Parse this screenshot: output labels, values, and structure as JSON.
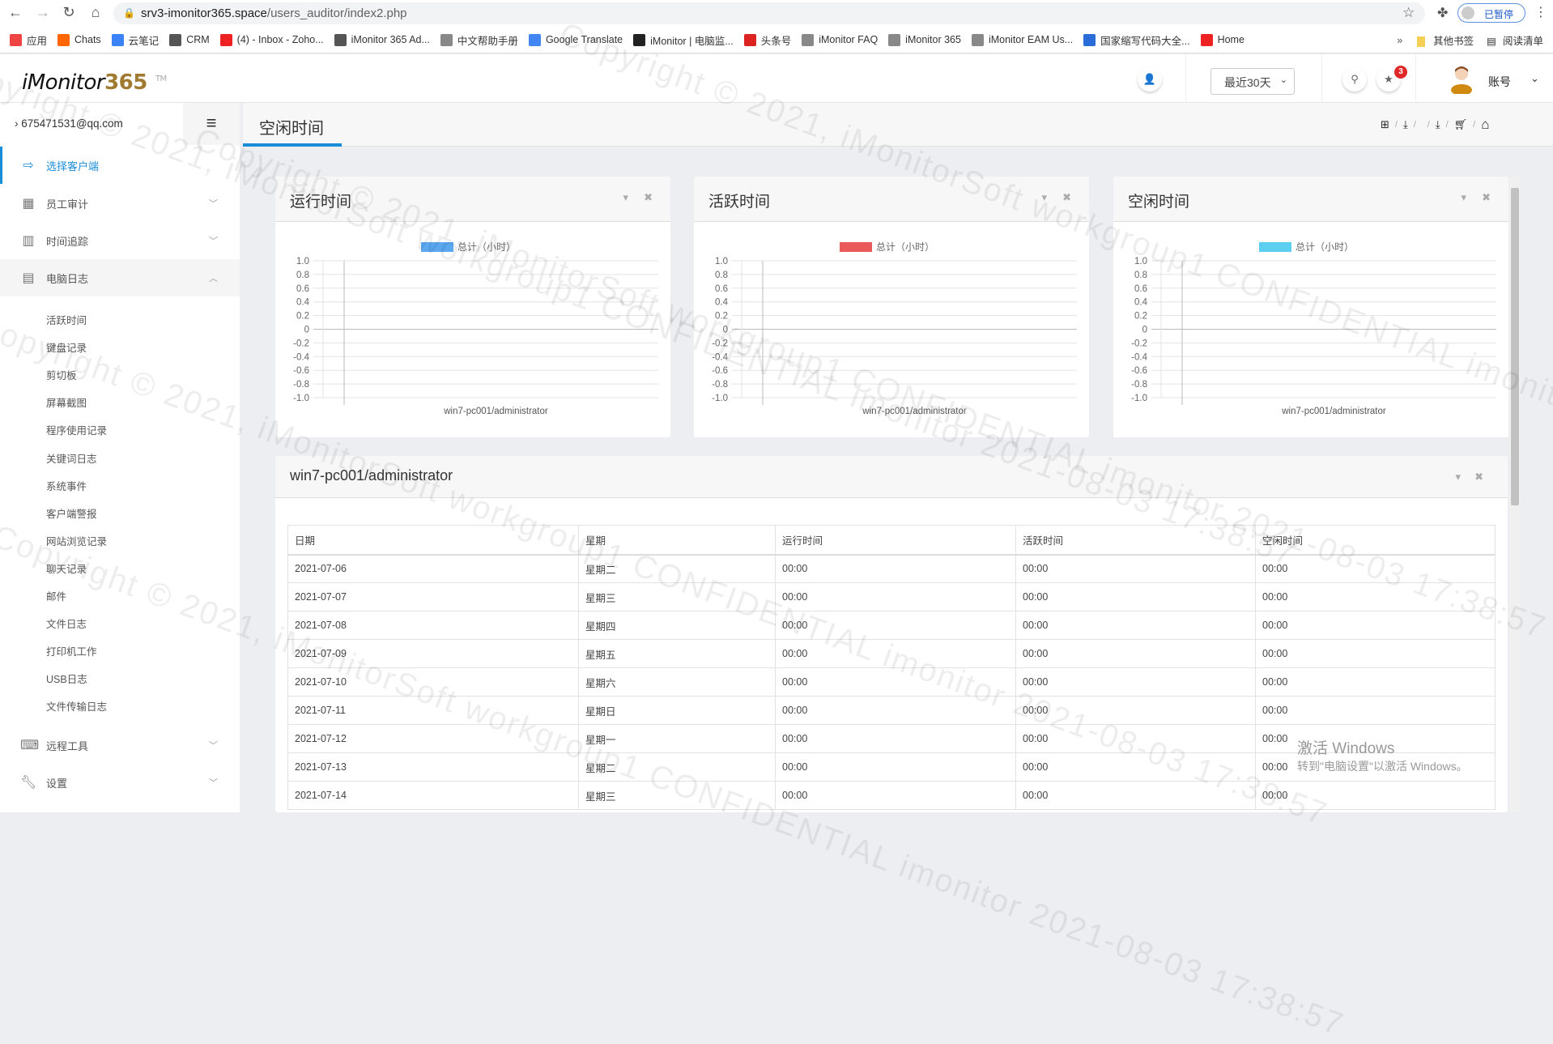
{
  "browser": {
    "url_host": "srv3-imonitor365.space",
    "url_path": "/users_auditor/index2.php",
    "profile_status": "已暂停",
    "bookmarks": [
      "应用",
      "Chats",
      "云笔记",
      "CRM",
      "(4) - Inbox - Zoho...",
      "iMonitor 365 Ad...",
      "中文帮助手册",
      "Google Translate",
      "iMonitor | 电脑监...",
      "头条号",
      "iMonitor FAQ",
      "iMonitor 365",
      "iMonitor EAM Us...",
      "国家缩写代码大全...",
      "Home"
    ],
    "bookmarks_more": "»",
    "other_bookmarks": "其他书签",
    "reading_list": "阅读清单"
  },
  "header": {
    "logo_text": "iMonitor",
    "logo_num": "365",
    "logo_tm": "TM",
    "range_select": "最近30天",
    "notification_count": "3",
    "account_label": "账号"
  },
  "sidebar": {
    "user_email": "675471531@qq.com",
    "items": [
      {
        "label": "选择客户端",
        "icon": "sign-in-icon"
      },
      {
        "label": "员工审计",
        "icon": "calendar-icon"
      },
      {
        "label": "时间追踪",
        "icon": "bar-chart-icon"
      },
      {
        "label": "电脑日志",
        "icon": "file-icon"
      },
      {
        "label": "远程工具",
        "icon": "keyboard-icon"
      },
      {
        "label": "设置",
        "icon": "wrench-icon"
      }
    ],
    "sub_items": [
      "活跃时间",
      "键盘记录",
      "剪切板",
      "屏幕截图",
      "程序使用记录",
      "关键词日志",
      "系统事件",
      "客户端警报",
      "网站浏览记录",
      "聊天记录",
      "邮件",
      "文件日志",
      "打印机工作",
      "USB日志",
      "文件传输日志"
    ]
  },
  "page": {
    "title": "空闲时间",
    "toolbar_icons": [
      "windows-icon",
      "download-icon",
      "apple-icon",
      "download-icon",
      "cart-icon",
      "home-icon"
    ]
  },
  "chart_data": [
    {
      "type": "bar",
      "title": "运行时间",
      "legend": "总计（小时）",
      "color": "#5aa8f0",
      "categories": [
        "win7-pc001/administrator"
      ],
      "values": [
        0
      ],
      "ylim": [
        -1,
        1
      ],
      "yticks": [
        "1.0",
        "0.8",
        "0.6",
        "0.4",
        "0.2",
        "0",
        "-0.2",
        "-0.4",
        "-0.6",
        "-0.8",
        "-1.0"
      ],
      "grid": true,
      "legend_position": "top"
    },
    {
      "type": "bar",
      "title": "活跃时间",
      "legend": "总计（小时）",
      "color": "#ea5a5a",
      "categories": [
        "win7-pc001/administrator"
      ],
      "values": [
        0
      ],
      "ylim": [
        -1,
        1
      ],
      "yticks": [
        "1.0",
        "0.8",
        "0.6",
        "0.4",
        "0.2",
        "0",
        "-0.2",
        "-0.4",
        "-0.6",
        "-0.8",
        "-1.0"
      ],
      "grid": true,
      "legend_position": "top"
    },
    {
      "type": "bar",
      "title": "空闲时间",
      "legend": "总计（小时）",
      "color": "#5ccff0",
      "categories": [
        "win7-pc001/administrator"
      ],
      "values": [
        0
      ],
      "ylim": [
        -1,
        1
      ],
      "yticks": [
        "1.0",
        "0.8",
        "0.6",
        "0.4",
        "0.2",
        "0",
        "-0.2",
        "-0.4",
        "-0.6",
        "-0.8",
        "-1.0"
      ],
      "grid": true,
      "legend_position": "top"
    }
  ],
  "table_card": {
    "title": "win7-pc001/administrator",
    "columns": [
      "日期",
      "星期",
      "运行时间",
      "活跃时间",
      "空闲时间"
    ],
    "rows": [
      [
        "2021-07-06",
        "星期二",
        "00:00",
        "00:00",
        "00:00"
      ],
      [
        "2021-07-07",
        "星期三",
        "00:00",
        "00:00",
        "00:00"
      ],
      [
        "2021-07-08",
        "星期四",
        "00:00",
        "00:00",
        "00:00"
      ],
      [
        "2021-07-09",
        "星期五",
        "00:00",
        "00:00",
        "00:00"
      ],
      [
        "2021-07-10",
        "星期六",
        "00:00",
        "00:00",
        "00:00"
      ],
      [
        "2021-07-11",
        "星期日",
        "00:00",
        "00:00",
        "00:00"
      ],
      [
        "2021-07-12",
        "星期一",
        "00:00",
        "00:00",
        "00:00"
      ],
      [
        "2021-07-13",
        "星期二",
        "00:00",
        "00:00",
        "00:00"
      ],
      [
        "2021-07-14",
        "星期三",
        "00:00",
        "00:00",
        "00:00"
      ]
    ]
  },
  "os_overlay": {
    "activate_title": "激活 Windows",
    "activate_text": "转到\"电脑设置\"以激活 Windows。"
  },
  "watermark": "Copyright © 2021, iMonitorSoft workgroup1 CONFIDENTIAL imonitor 2021-08-03 17:38:57"
}
